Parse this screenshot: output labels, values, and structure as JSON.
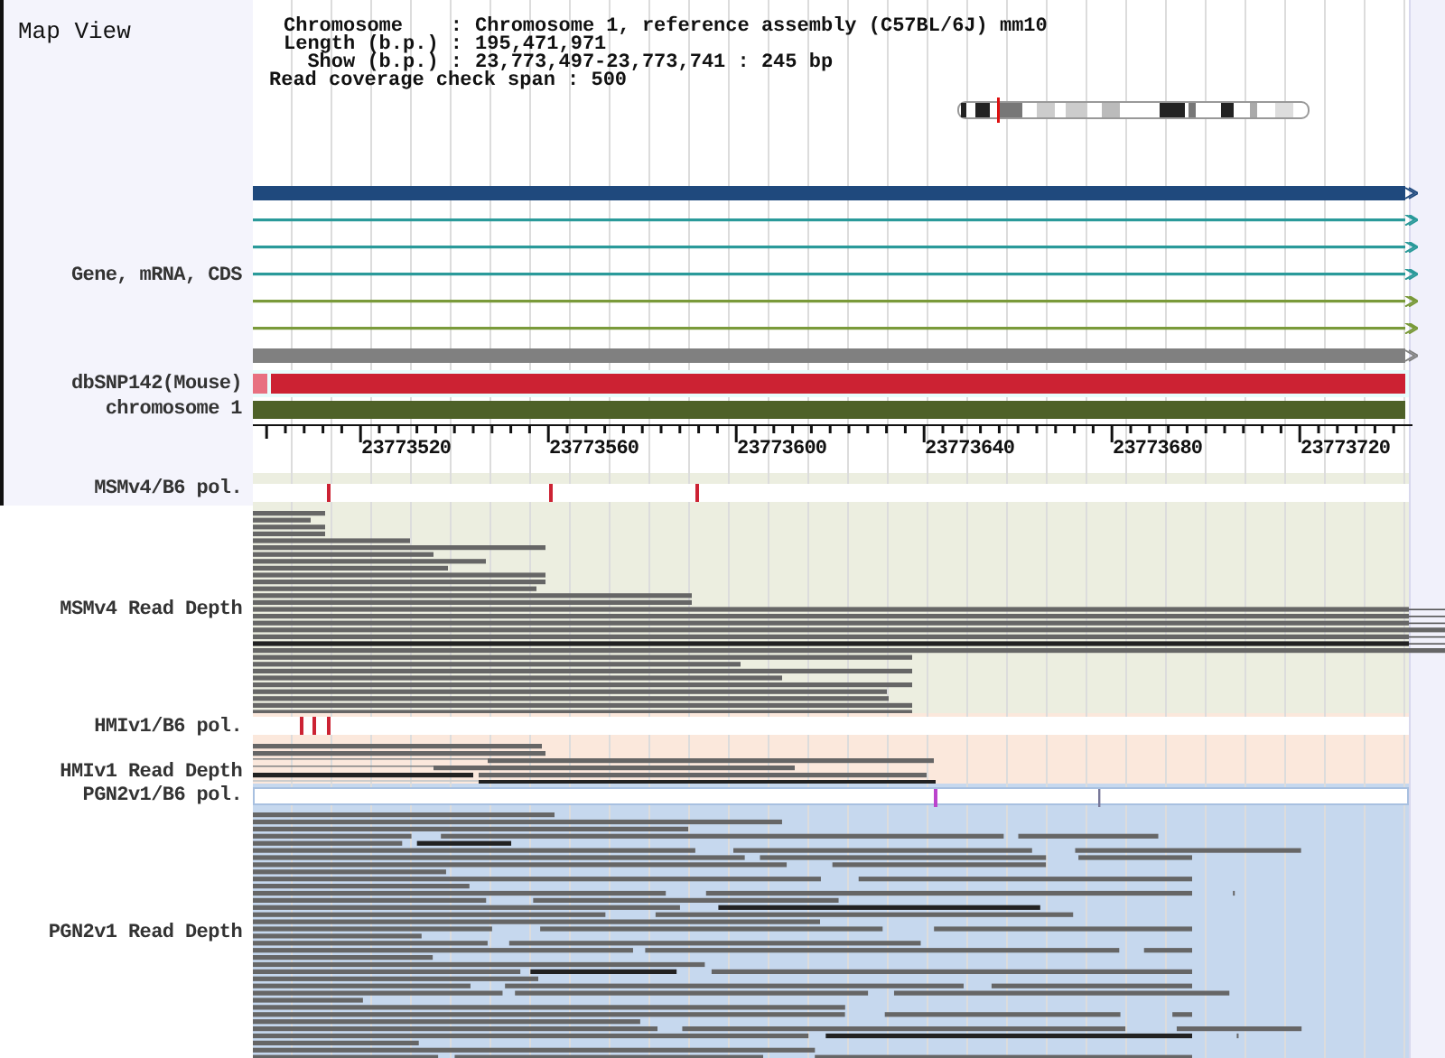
{
  "title": "Map View",
  "info": [
    {
      "label": "Chromosome    :",
      "value": "Chromosome 1, reference assembly (C57BL/6J) mm10"
    },
    {
      "label": "Length (b.p.) :",
      "value": "195,471,971"
    },
    {
      "label": "Show (b.p.) :",
      "value": "23,773,497-23,773,741 : 245 bp"
    }
  ],
  "coverage_span": {
    "label": "Read coverage check span :",
    "value": "500"
  },
  "tracks": [
    {
      "kind": "genes",
      "label": "Gene, mRNA, CDS",
      "features": [
        {
          "kind": "thick",
          "color": "#1f497d"
        },
        {
          "kind": "thin",
          "color": "#2a9a9a"
        },
        {
          "kind": "thin",
          "color": "#2a9a9a"
        },
        {
          "kind": "thin",
          "color": "#2a9a9a"
        },
        {
          "kind": "thin",
          "color": "#7a9a3a"
        },
        {
          "kind": "thin",
          "color": "#7a9a3a"
        },
        {
          "kind": "thick",
          "color": "#808080"
        }
      ]
    },
    {
      "kind": "snp",
      "label": "dbSNP142(Mouse)"
    },
    {
      "kind": "chromosome",
      "label": "chromosome 1"
    },
    {
      "kind": "axis",
      "ticks": [
        "23773520",
        "23773560",
        "23773600",
        "23773640",
        "23773680",
        "23773720"
      ]
    },
    {
      "kind": "pol",
      "label": "MSMv4/B6 pol.",
      "color": "#cc2233"
    },
    {
      "kind": "depth",
      "label": "MSMv4 Read Depth",
      "color": "#eceee0"
    },
    {
      "kind": "pol",
      "label": "HMIv1/B6 pol.",
      "color": "#cc2233"
    },
    {
      "kind": "depth",
      "label": "HMIv1 Read Depth",
      "color": "#fbe8dc"
    },
    {
      "kind": "pol",
      "label": "PGN2v1/B6 pol.",
      "color": "#bb44cc"
    },
    {
      "kind": "depth",
      "label": "PGN2v1 Read Depth",
      "color": "#c6d8ee"
    }
  ]
}
